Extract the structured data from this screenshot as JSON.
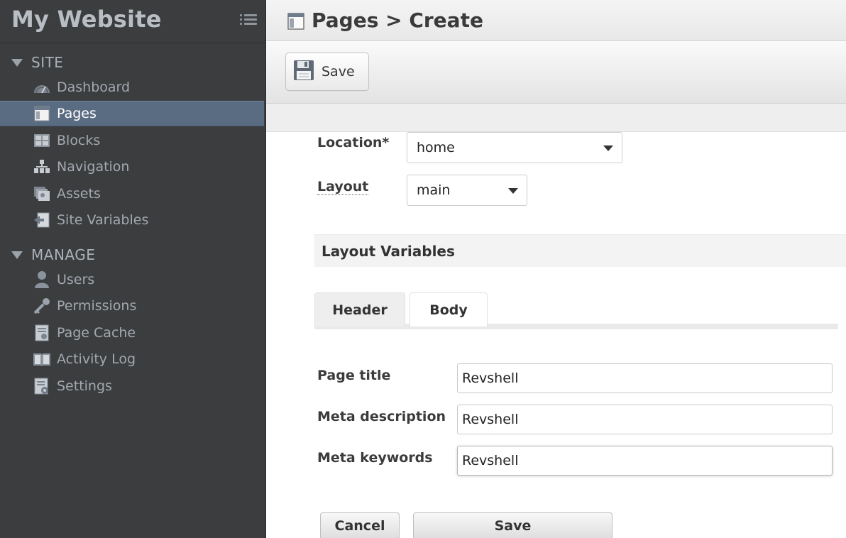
{
  "sidebar": {
    "site_title": "My Website",
    "sections": [
      {
        "title": "SITE",
        "items": [
          {
            "label": "Dashboard",
            "icon": "dashboard-icon"
          },
          {
            "label": "Pages",
            "icon": "page-icon",
            "active": true
          },
          {
            "label": "Blocks",
            "icon": "blocks-icon"
          },
          {
            "label": "Navigation",
            "icon": "navigation-icon"
          },
          {
            "label": "Assets",
            "icon": "assets-icon"
          },
          {
            "label": "Site Variables",
            "icon": "site-variables-icon"
          }
        ]
      },
      {
        "title": "MANAGE",
        "items": [
          {
            "label": "Users",
            "icon": "user-icon"
          },
          {
            "label": "Permissions",
            "icon": "key-icon"
          },
          {
            "label": "Page Cache",
            "icon": "page-cache-icon"
          },
          {
            "label": "Activity Log",
            "icon": "book-icon"
          },
          {
            "label": "Settings",
            "icon": "settings-icon"
          }
        ]
      }
    ]
  },
  "header": {
    "title": "Pages > Create"
  },
  "toolbar": {
    "save_label": "Save"
  },
  "form": {
    "location": {
      "label": "Location*",
      "value": "home"
    },
    "layout": {
      "label": "Layout",
      "value": "main"
    },
    "layout_variables_title": "Layout Variables",
    "tabs": [
      {
        "label": "Header",
        "active": true
      },
      {
        "label": "Body",
        "active": false
      }
    ],
    "fields": [
      {
        "label": "Page title",
        "value": "Revshell"
      },
      {
        "label": "Meta description",
        "value": "Revshell"
      },
      {
        "label": "Meta keywords",
        "value": "Revshell"
      }
    ],
    "cancel_label": "Cancel",
    "save_label": "Save"
  },
  "colors": {
    "sidebar_bg": "#3b3d3f",
    "sidebar_active_bg": "#5a6c82",
    "sidebar_text": "#a3a9af",
    "header_bg": "#eeeeee"
  }
}
